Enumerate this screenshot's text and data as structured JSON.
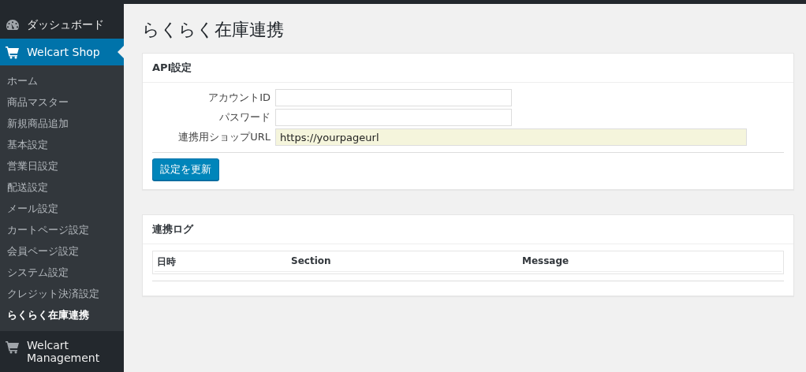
{
  "sidebar": {
    "menu": [
      {
        "label": "ダッシュボード",
        "kind": "dashboard",
        "selected": false
      },
      {
        "label": "Welcart Shop",
        "kind": "cart",
        "selected": true,
        "submenu": [
          {
            "label": "ホーム",
            "selected": false
          },
          {
            "label": "商品マスター",
            "selected": false
          },
          {
            "label": "新規商品追加",
            "selected": false
          },
          {
            "label": "基本設定",
            "selected": false
          },
          {
            "label": "営業日設定",
            "selected": false
          },
          {
            "label": "配送設定",
            "selected": false
          },
          {
            "label": "メール設定",
            "selected": false
          },
          {
            "label": "カートページ設定",
            "selected": false
          },
          {
            "label": "会員ページ設定",
            "selected": false
          },
          {
            "label": "システム設定",
            "selected": false
          },
          {
            "label": "クレジット決済設定",
            "selected": false
          },
          {
            "label": "らくらく在庫連携",
            "selected": true
          }
        ]
      },
      {
        "label": "Welcart Management",
        "kind": "cart",
        "selected": false
      }
    ]
  },
  "page": {
    "title": "らくらく在庫連携",
    "api_settings": {
      "title": "API設定",
      "fields": [
        {
          "label": "アカウントID",
          "kind": "short",
          "highlighted": false
        },
        {
          "label": "パスワード",
          "kind": "short",
          "highlighted": false
        },
        {
          "label": "連携用ショップURL",
          "kind": "long",
          "value": "https://yourpageurl",
          "highlighted": true
        }
      ],
      "button": "設定を更新"
    },
    "log": {
      "title": "連携ログ",
      "table": {
        "columns": [
          "日時",
          "Section",
          "Message"
        ]
      }
    }
  }
}
